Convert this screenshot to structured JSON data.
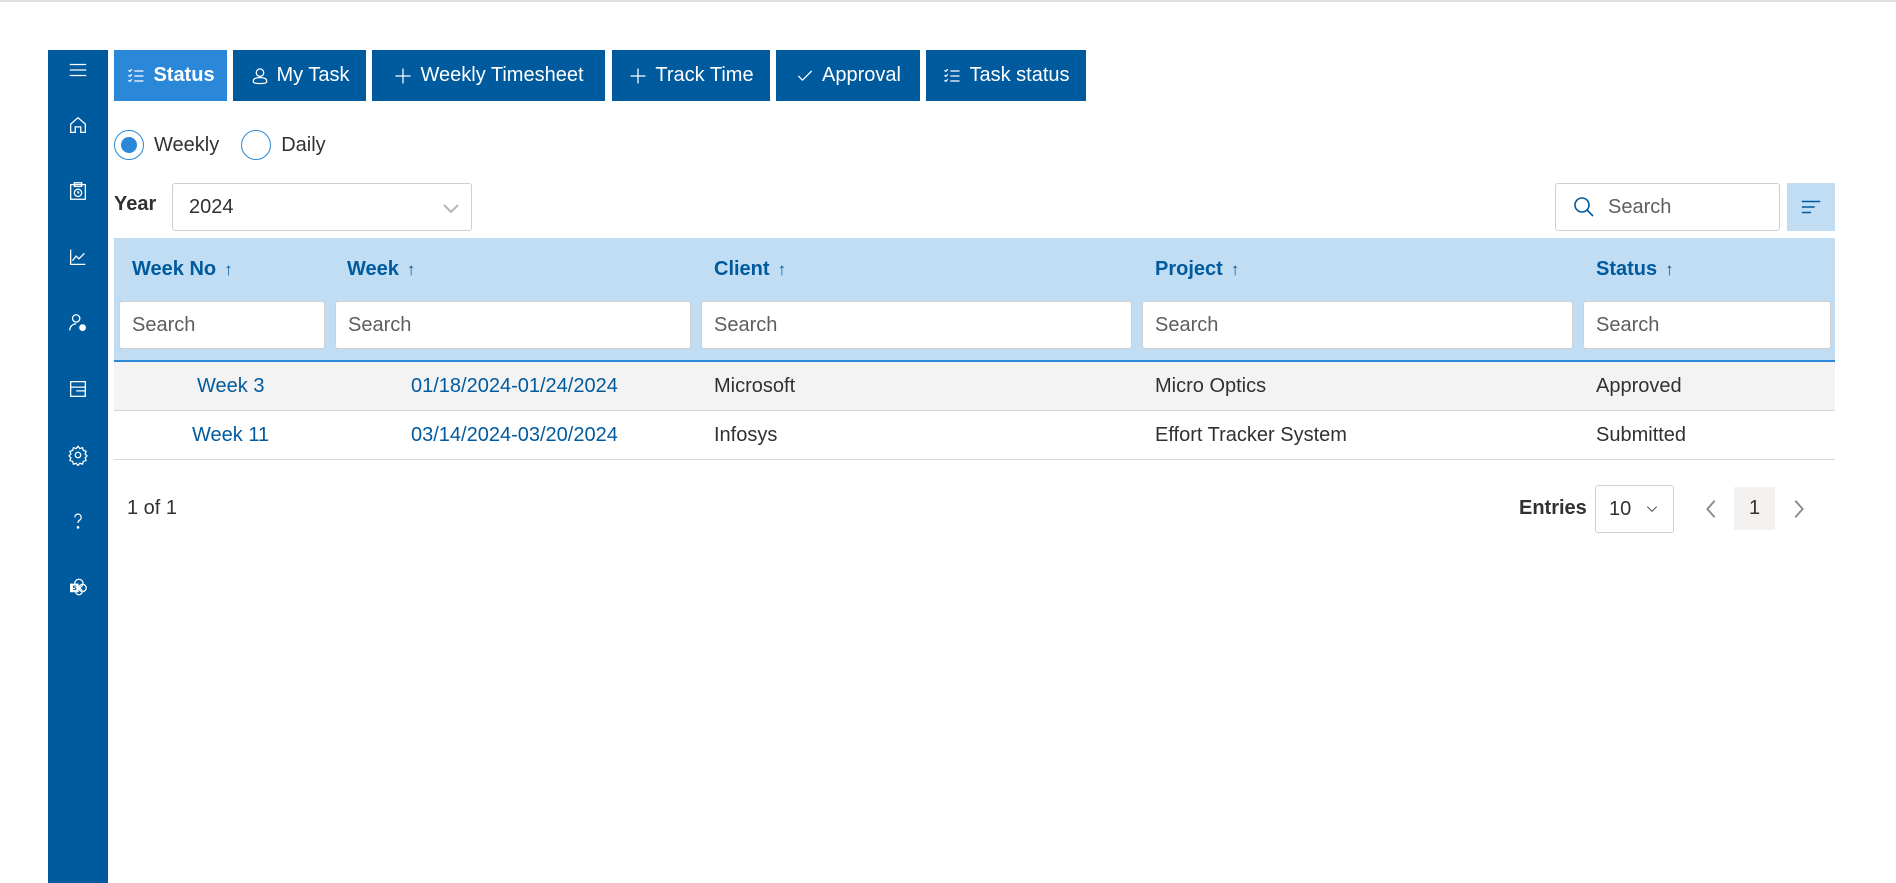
{
  "sidebar": {
    "items": [
      {
        "name": "menu",
        "icon": "hamburger-menu-icon"
      },
      {
        "name": "home",
        "icon": "home-icon"
      },
      {
        "name": "timesheet",
        "icon": "clipboard-clock-icon"
      },
      {
        "name": "reports",
        "icon": "line-chart-icon"
      },
      {
        "name": "user-settings",
        "icon": "person-gear-icon"
      },
      {
        "name": "layout",
        "icon": "layout-panel-icon"
      },
      {
        "name": "settings",
        "icon": "gear-icon"
      },
      {
        "name": "help",
        "icon": "question-icon"
      },
      {
        "name": "sharepoint",
        "icon": "sharepoint-icon"
      }
    ]
  },
  "toolbar": {
    "buttons": [
      {
        "label": "Status",
        "icon": "checklist-icon",
        "active": true
      },
      {
        "label": "My Task",
        "icon": "person-icon",
        "active": false
      },
      {
        "label": "Weekly Timesheet",
        "icon": "plus-icon",
        "active": false
      },
      {
        "label": "Track Time",
        "icon": "plus-icon",
        "active": false
      },
      {
        "label": "Approval",
        "icon": "checkmark-icon",
        "active": false
      },
      {
        "label": "Task status",
        "icon": "checklist-icon",
        "active": false
      }
    ]
  },
  "view_mode": {
    "options": [
      {
        "label": "Weekly",
        "selected": true
      },
      {
        "label": "Daily",
        "selected": false
      }
    ]
  },
  "year_filter": {
    "label": "Year",
    "value": "2024"
  },
  "search": {
    "placeholder": "Search"
  },
  "table": {
    "columns": [
      {
        "label": "Week No",
        "sort": "ascending"
      },
      {
        "label": "Week",
        "sort": "ascending"
      },
      {
        "label": "Client",
        "sort": "ascending"
      },
      {
        "label": "Project",
        "sort": "ascending"
      },
      {
        "label": "Status",
        "sort": "ascending"
      }
    ],
    "sort_arrow": "↑",
    "filter_placeholder": "Search",
    "rows": [
      {
        "week_no": "Week 3",
        "week": "01/18/2024-01/24/2024",
        "client": "Microsoft",
        "project": "Micro Optics",
        "status": "Approved"
      },
      {
        "week_no": "Week 11",
        "week": "03/14/2024-03/20/2024",
        "client": "Infosys",
        "project": "Effort Tracker System",
        "status": "Submitted"
      }
    ]
  },
  "footer": {
    "page_info": "1 of 1",
    "entries_label": "Entries",
    "entries_value": "10",
    "current_page": "1"
  },
  "colors": {
    "primary": "#005a9e",
    "active_tab": "#2b88d8",
    "header_bg": "#c0ddf3",
    "alt_row": "#f3f3f3"
  }
}
